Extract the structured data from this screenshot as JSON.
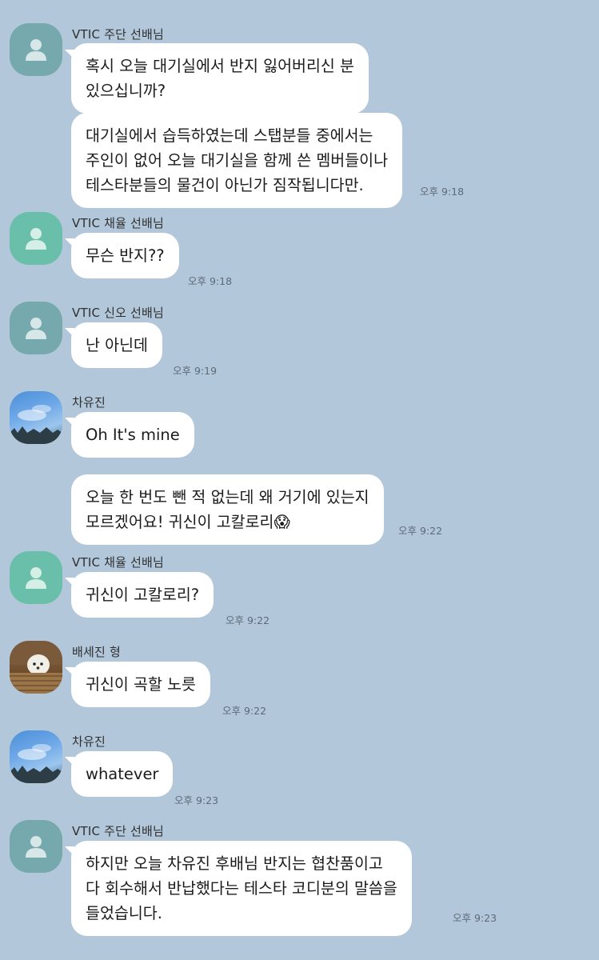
{
  "chat": {
    "messages": [
      {
        "sender": "VTIC 주단 선배님",
        "lines": [
          "혹시 오늘 대기실에서 반지 잃어버리신 분\n있으십니까?",
          "대기실에서 습득하였는데 스탭분들 중에서는\n주인이 없어 오늘 대기실을 함께 쓴 멤버들이나\n테스타분들의 물건이 아닌가 짐작됩니다만."
        ],
        "time": "오후 9:18",
        "avatar": "person-icon"
      },
      {
        "sender": "VTIC 채율 선배님",
        "lines": [
          "무슨 반지??"
        ],
        "time": "오후 9:18",
        "avatar": "person-icon"
      },
      {
        "sender": "VTIC 신오 선배님",
        "lines": [
          "난 아닌데"
        ],
        "time": "오후 9:19",
        "avatar": "person-icon"
      },
      {
        "sender": "차유진",
        "lines": [
          "Oh It's mine",
          "오늘 한 번도 뺀 적 없는데 왜 거기에 있는지\n모르겠어요! 귀신이 고칼로리😱"
        ],
        "time": "오후 9:22",
        "avatar": "sky-photo"
      },
      {
        "sender": "VTIC 채율 선배님",
        "lines": [
          "귀신이 고칼로리?"
        ],
        "time": "오후 9:22",
        "avatar": "person-icon"
      },
      {
        "sender": "배세진 형",
        "lines": [
          "귀신이 곡할 노릇"
        ],
        "time": "오후 9:22",
        "avatar": "dog-photo"
      },
      {
        "sender": "차유진",
        "lines": [
          "whatever"
        ],
        "time": "오후 9:23",
        "avatar": "sky-photo"
      },
      {
        "sender": "VTIC 주단 선배님",
        "lines": [
          "하지만 오늘 차유진 후배님 반지는 협찬품이고\n다 회수해서 반납했다는 테스타 코디분의 말씀을\n들었습니다."
        ],
        "time": "오후 9:23",
        "avatar": "person-icon"
      }
    ]
  },
  "colors": {
    "background": "#b2c7da",
    "bubble": "#ffffff"
  }
}
